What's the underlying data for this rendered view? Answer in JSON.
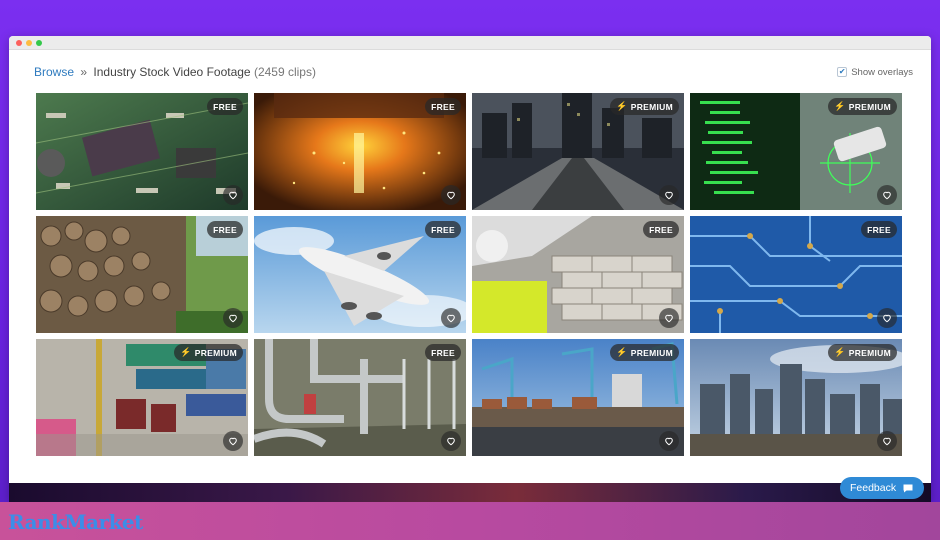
{
  "breadcrumb": {
    "browse": "Browse",
    "separator": "»",
    "title": "Industry Stock Video Footage",
    "count": "(2459 clips)"
  },
  "overlays": {
    "label": "Show overlays",
    "checked": true
  },
  "tiles": [
    {
      "badge": "FREE",
      "premium": false,
      "icon": "heart-icon"
    },
    {
      "badge": "FREE",
      "premium": false,
      "icon": "heart-icon"
    },
    {
      "badge": "PREMIUM",
      "premium": true,
      "icon": "heart-icon"
    },
    {
      "badge": "PREMIUM",
      "premium": true,
      "icon": "heart-icon"
    },
    {
      "badge": "FREE",
      "premium": false,
      "icon": "heart-icon"
    },
    {
      "badge": "FREE",
      "premium": false,
      "icon": "heart-icon"
    },
    {
      "badge": "FREE",
      "premium": false,
      "icon": "heart-icon"
    },
    {
      "badge": "FREE",
      "premium": false,
      "icon": "heart-icon"
    },
    {
      "badge": "PREMIUM",
      "premium": true,
      "icon": "heart-icon"
    },
    {
      "badge": "FREE",
      "premium": false,
      "icon": "heart-icon"
    },
    {
      "badge": "PREMIUM",
      "premium": true,
      "icon": "heart-icon"
    },
    {
      "badge": "PREMIUM",
      "premium": true,
      "icon": "heart-icon"
    }
  ],
  "feedback": {
    "label": "Feedback",
    "icon": "chat-bubble-icon"
  },
  "logo": {
    "text": "RankMarket"
  },
  "colors": {
    "accent": "#2f7bbf",
    "feedback": "#2f8ad6",
    "background": "#6a22e0"
  }
}
